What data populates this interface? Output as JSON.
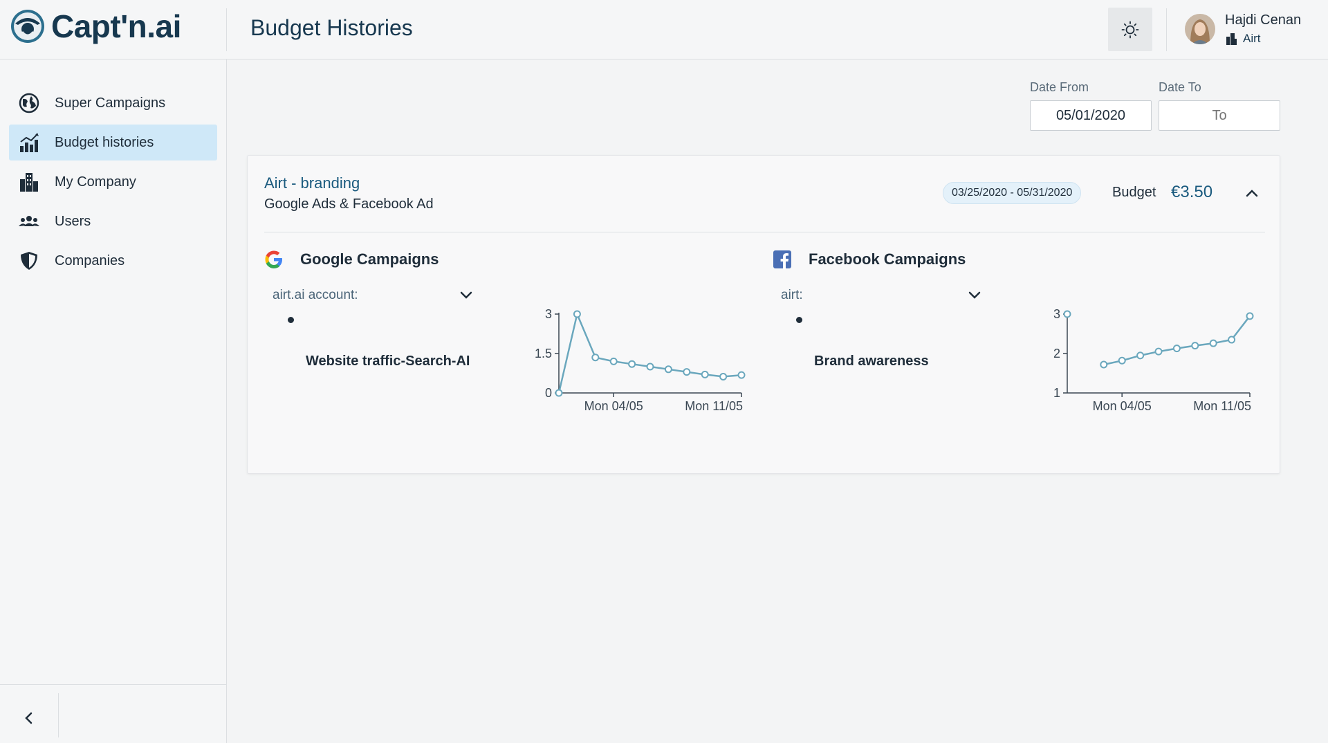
{
  "header": {
    "logo_text": "Capt'n.ai",
    "page_title": "Budget Histories",
    "user": {
      "name": "Hajdi Cenan",
      "company": "Airt"
    }
  },
  "sidebar": {
    "items": [
      {
        "label": "Super Campaigns",
        "icon": "globe-icon",
        "active": false
      },
      {
        "label": "Budget histories",
        "icon": "bar-chart-icon",
        "active": true
      },
      {
        "label": "My Company",
        "icon": "building-icon",
        "active": false
      },
      {
        "label": "Users",
        "icon": "users-icon",
        "active": false
      },
      {
        "label": "Companies",
        "icon": "shield-icon",
        "active": false
      }
    ]
  },
  "filters": {
    "date_from": {
      "label": "Date From",
      "value": "05/01/2020"
    },
    "date_to": {
      "label": "Date To",
      "placeholder": "To"
    }
  },
  "campaign": {
    "title": "Airt - branding",
    "subtitle": "Google Ads & Facebook Ad",
    "date_range": "03/25/2020 - 05/31/2020",
    "budget_label": "Budget",
    "budget_value": "€3.50",
    "google": {
      "title": "Google Campaigns",
      "account_label": "airt.ai account:",
      "sub_campaign": "Website traffic-Search-AI"
    },
    "facebook": {
      "title": "Facebook Campaigns",
      "account_label": "airt:",
      "sub_campaign": "Brand awareness"
    }
  },
  "colors": {
    "accent": "#1a5a7e",
    "line": "#6aa7bd",
    "active_nav": "#cfe8f8"
  },
  "chart_data": [
    {
      "type": "line",
      "series_label": "Website traffic-Search-AI",
      "x_ticks": [
        "Mon 04/05",
        "Mon 11/05"
      ],
      "y_ticks": [
        "0",
        "1.5",
        "3"
      ],
      "ylim": [
        0,
        3
      ],
      "values": [
        0.0,
        3.0,
        1.35,
        1.2,
        1.1,
        1.0,
        0.9,
        0.8,
        0.7,
        0.62,
        0.68
      ]
    },
    {
      "type": "line",
      "series_label": "Brand awareness",
      "x_ticks": [
        "Mon 04/05",
        "Mon 11/05"
      ],
      "y_ticks": [
        "1",
        "2",
        "3"
      ],
      "ylim": [
        1,
        3
      ],
      "values": [
        3.0,
        null,
        1.72,
        1.82,
        1.95,
        2.05,
        2.13,
        2.2,
        2.26,
        2.35,
        2.95
      ]
    }
  ]
}
